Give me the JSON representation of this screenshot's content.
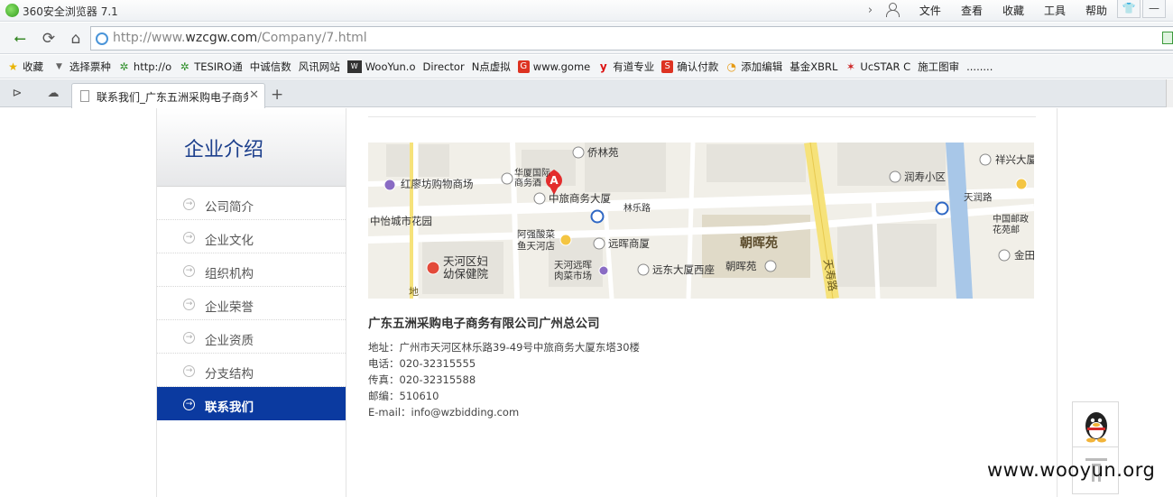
{
  "browser": {
    "title": "360安全浏览器 7.1",
    "menu": [
      "文件",
      "查看",
      "收藏",
      "工具",
      "帮助"
    ],
    "url_prefix": "http://www.",
    "url_host": "wzcgw.com",
    "url_path": "/Company/7.html",
    "bookmarks": [
      {
        "label": "收藏",
        "icon": "star-icon"
      },
      {
        "label": "选择票种",
        "icon": "page-icon"
      },
      {
        "label": "http://o",
        "icon": "gear-icon"
      },
      {
        "label": "TESIRO通",
        "icon": "gear-icon"
      },
      {
        "label": "中诚信数",
        "icon": "page-icon"
      },
      {
        "label": "风讯网站",
        "icon": "page-icon"
      },
      {
        "label": "WooYun.o",
        "icon": "wooyun-icon"
      },
      {
        "label": "Director",
        "icon": "page-icon"
      },
      {
        "label": "N点虚拟",
        "icon": "page-icon"
      },
      {
        "label": "www.gome",
        "icon": "gome-icon"
      },
      {
        "label": "有道专业",
        "icon": "youdao-icon"
      },
      {
        "label": "确认付款",
        "icon": "s-icon"
      },
      {
        "label": "添加编辑",
        "icon": "swirl-icon"
      },
      {
        "label": "基金XBRL",
        "icon": "page-icon"
      },
      {
        "label": "UcSTAR C",
        "icon": "star-icon"
      },
      {
        "label": "施工图审",
        "icon": "page-icon"
      },
      {
        "label": "........",
        "icon": "page-icon"
      }
    ],
    "tab_title": "联系我们_广东五洲采购电子商务",
    "new_tab": "+"
  },
  "sidebar": {
    "title": "企业介绍",
    "items": [
      {
        "label": "公司简介",
        "active": false
      },
      {
        "label": "企业文化",
        "active": false
      },
      {
        "label": "组织机构",
        "active": false
      },
      {
        "label": "企业荣誉",
        "active": false
      },
      {
        "label": "企业资质",
        "active": false
      },
      {
        "label": "分支结构",
        "active": false
      },
      {
        "label": "联系我们",
        "active": true
      }
    ]
  },
  "map": {
    "marker": "A",
    "labels": [
      "侨林苑",
      "华厦国际",
      "商务酒",
      "红廖坊购物商场",
      "中旅商务大厦",
      "林乐路",
      "中怡城市花园",
      "阿强酸菜",
      "鱼天河店",
      "远晖商厦",
      "朝晖苑",
      "天河区妇",
      "幼保健院",
      "天河远晖",
      "肉菜市场",
      "远东大厦西座",
      "朝晖苑",
      "天寿路",
      "润寿小区",
      "天润路",
      "祥兴大厦",
      "中国邮政",
      "花苑邮",
      "金田",
      "地"
    ]
  },
  "contact": {
    "company": "广东五洲采购电子商务有限公司广州总公司",
    "address": "地址：广州市天河区林乐路39-49号中旅商务大厦东塔30楼",
    "phone": "电话：020-32315555",
    "fax": "传真：020-32315588",
    "zip": "邮编：510610",
    "email": "E-mail：info@wzbidding.com"
  },
  "watermark": "www.wooyun.org",
  "colors": {
    "accent": "#0b3aa0",
    "sidebar_title": "#1c3f8c"
  }
}
